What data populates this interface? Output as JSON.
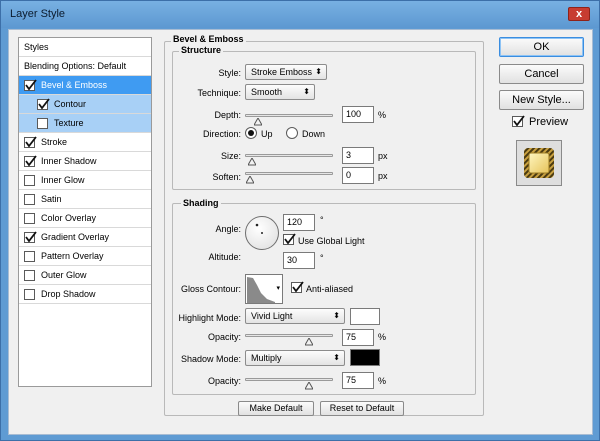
{
  "window": {
    "title": "Layer Style",
    "close_glyph": "x"
  },
  "styles_list": {
    "header": "Styles",
    "blending": "Blending Options: Default",
    "items": [
      {
        "label": "Bevel & Emboss",
        "checked": true
      },
      {
        "label": "Contour",
        "checked": true
      },
      {
        "label": "Texture",
        "checked": false
      },
      {
        "label": "Stroke",
        "checked": true
      },
      {
        "label": "Inner Shadow",
        "checked": true
      },
      {
        "label": "Inner Glow",
        "checked": false
      },
      {
        "label": "Satin",
        "checked": false
      },
      {
        "label": "Color Overlay",
        "checked": false
      },
      {
        "label": "Gradient Overlay",
        "checked": true
      },
      {
        "label": "Pattern Overlay",
        "checked": false
      },
      {
        "label": "Outer Glow",
        "checked": false
      },
      {
        "label": "Drop Shadow",
        "checked": false
      }
    ]
  },
  "bevel": {
    "heading": "Bevel & Emboss",
    "structure_heading": "Structure",
    "style_label": "Style:",
    "style_value": "Stroke Emboss",
    "technique_label": "Technique:",
    "technique_value": "Smooth",
    "depth_label": "Depth:",
    "depth_value": "100",
    "depth_unit": "%",
    "depth_level": 0.1,
    "direction_label": "Direction:",
    "direction_up": "Up",
    "direction_down": "Down",
    "direction_selected": "Up",
    "size_label": "Size:",
    "size_value": "3",
    "size_unit": "px",
    "size_level": 0.03,
    "soften_label": "Soften:",
    "soften_value": "0",
    "soften_unit": "px",
    "soften_level": 0
  },
  "shading": {
    "heading": "Shading",
    "angle_label": "Angle:",
    "angle_value": "120",
    "angle_unit": "°",
    "global_light_label": "Use Global Light",
    "global_light_checked": true,
    "altitude_label": "Altitude:",
    "altitude_value": "30",
    "altitude_unit": "°",
    "gloss_label": "Gloss Contour:",
    "anti_aliased_label": "Anti-aliased",
    "anti_aliased_checked": true,
    "highlight_mode_label": "Highlight Mode:",
    "highlight_mode_value": "Vivid Light",
    "highlight_color": "#ffffff",
    "highlight_opacity_label": "Opacity:",
    "highlight_opacity_value": "75",
    "highlight_opacity_unit": "%",
    "highlight_opacity_level": 0.75,
    "shadow_mode_label": "Shadow Mode:",
    "shadow_mode_value": "Multiply",
    "shadow_color": "#000000",
    "shadow_opacity_label": "Opacity:",
    "shadow_opacity_value": "75",
    "shadow_opacity_unit": "%",
    "shadow_opacity_level": 0.75
  },
  "footer": {
    "make_default": "Make Default",
    "reset_default": "Reset to Default"
  },
  "side": {
    "ok": "OK",
    "cancel": "Cancel",
    "new_style": "New Style...",
    "preview_label": "Preview",
    "preview_checked": true
  },
  "colors": {
    "selection": "#3f9bf2",
    "sub_selection": "#a8d0f6",
    "titlebar": "#5d98d1"
  }
}
